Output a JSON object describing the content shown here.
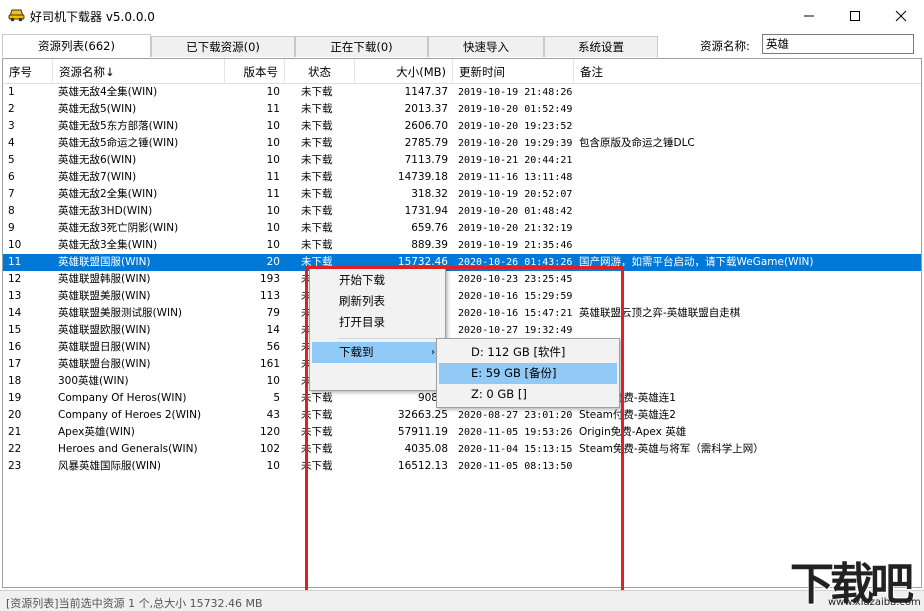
{
  "window": {
    "title": "好司机下载器 v5.0.0.0",
    "minimize_icon": "minimize-icon",
    "maximize_icon": "maximize-icon",
    "close_icon": "close-icon"
  },
  "tabs": [
    {
      "label": "资源列表(662)",
      "active": true
    },
    {
      "label": "已下载资源(0)",
      "active": false
    },
    {
      "label": "正在下载(0)",
      "active": false
    },
    {
      "label": "快速导入",
      "active": false
    },
    {
      "label": "系统设置",
      "active": false
    }
  ],
  "search": {
    "label": "资源名称:",
    "value": "英雄"
  },
  "table": {
    "headers": [
      "序号",
      "资源名称↓",
      "版本号",
      "状态",
      "大小(MB)",
      "更新时间",
      "备注"
    ],
    "selected_index": 10,
    "rows": [
      [
        "1",
        "英雄无敌4全集(WIN)",
        "10",
        "未下载",
        "1147.37",
        "2019-10-19 21:48:26",
        ""
      ],
      [
        "2",
        "英雄无敌5(WIN)",
        "11",
        "未下载",
        "2013.37",
        "2019-10-20 01:52:49",
        ""
      ],
      [
        "3",
        "英雄无敌5东方部落(WIN)",
        "10",
        "未下载",
        "2606.70",
        "2019-10-20 19:23:52",
        ""
      ],
      [
        "4",
        "英雄无敌5命运之锤(WIN)",
        "10",
        "未下载",
        "2785.79",
        "2019-10-20 19:29:39",
        "包含原版及命运之锤DLC"
      ],
      [
        "5",
        "英雄无敌6(WIN)",
        "10",
        "未下载",
        "7113.79",
        "2019-10-21 20:44:21",
        ""
      ],
      [
        "6",
        "英雄无敌7(WIN)",
        "11",
        "未下载",
        "14739.18",
        "2019-11-16 13:11:48",
        ""
      ],
      [
        "7",
        "英雄无敌2全集(WIN)",
        "11",
        "未下载",
        "318.32",
        "2019-10-19 20:52:07",
        ""
      ],
      [
        "8",
        "英雄无敌3HD(WIN)",
        "10",
        "未下载",
        "1731.94",
        "2019-10-20 01:48:42",
        ""
      ],
      [
        "9",
        "英雄无敌3死亡阴影(WIN)",
        "10",
        "未下载",
        "659.76",
        "2019-10-20 21:32:19",
        ""
      ],
      [
        "10",
        "英雄无敌3全集(WIN)",
        "10",
        "未下载",
        "889.39",
        "2019-10-19 21:35:46",
        ""
      ],
      [
        "11",
        "英雄联盟国服(WIN)",
        "20",
        "未下载",
        "15732.46",
        "2020-10-26 01:43:26",
        "国产网游，如需平台启动，请下载WeGame(WIN)"
      ],
      [
        "12",
        "英雄联盟韩服(WIN)",
        "193",
        "未",
        "",
        "2020-10-23 23:25:45",
        ""
      ],
      [
        "13",
        "英雄联盟美服(WIN)",
        "113",
        "未",
        "",
        "2020-10-16 15:29:59",
        ""
      ],
      [
        "14",
        "英雄联盟美服测试服(WIN)",
        "79",
        "未",
        "",
        "2020-10-16 15:47:21",
        "英雄联盟云顶之弈-英雄联盟自走棋"
      ],
      [
        "15",
        "英雄联盟欧服(WIN)",
        "14",
        "未",
        "",
        "2020-10-27 19:32:49",
        ""
      ],
      [
        "16",
        "英雄联盟日服(WIN)",
        "56",
        "未",
        "",
        "",
        ""
      ],
      [
        "17",
        "英雄联盟台服(WIN)",
        "161",
        "未",
        "",
        "",
        ""
      ],
      [
        "18",
        "300英雄(WIN)",
        "10",
        "未下载",
        "5202.",
        "",
        "游"
      ],
      [
        "19",
        "Company Of Heros(WIN)",
        "5",
        "未下载",
        "9088.",
        "",
        "Steam付费-英雄连1"
      ],
      [
        "20",
        "Company of Heroes 2(WIN)",
        "43",
        "未下载",
        "32663.25",
        "2020-08-27 23:01:20",
        "Steam付费-英雄连2"
      ],
      [
        "21",
        "Apex英雄(WIN)",
        "120",
        "未下载",
        "57911.19",
        "2020-11-05 19:53:26",
        "Origin免费-Apex 英雄"
      ],
      [
        "22",
        "Heroes and Generals(WIN)",
        "102",
        "未下载",
        "4035.08",
        "2020-11-04 15:13:15",
        "Steam免费-英雄与将军（需科学上网）"
      ],
      [
        "23",
        "风暴英雄国际服(WIN)",
        "10",
        "未下载",
        "16512.13",
        "2020-11-05 08:13:50",
        ""
      ]
    ]
  },
  "context_menu": {
    "items": [
      "开始下载",
      "刷新列表",
      "打开目录"
    ],
    "download_to": "下载到",
    "submenu": [
      "D: 112 GB [软件]",
      "E: 59 GB [备份]",
      "Z: 0 GB []"
    ],
    "hovered_sub": 1
  },
  "status": "[资源列表]当前选中资源 1 个,总大小 15732.46 MB",
  "watermark": {
    "big": "下载吧",
    "small": "www.xiazaiba.com"
  },
  "colors": {
    "selection": "#0078d7",
    "menu_hover": "#91c9f7",
    "highlight_box": "#e02020"
  }
}
